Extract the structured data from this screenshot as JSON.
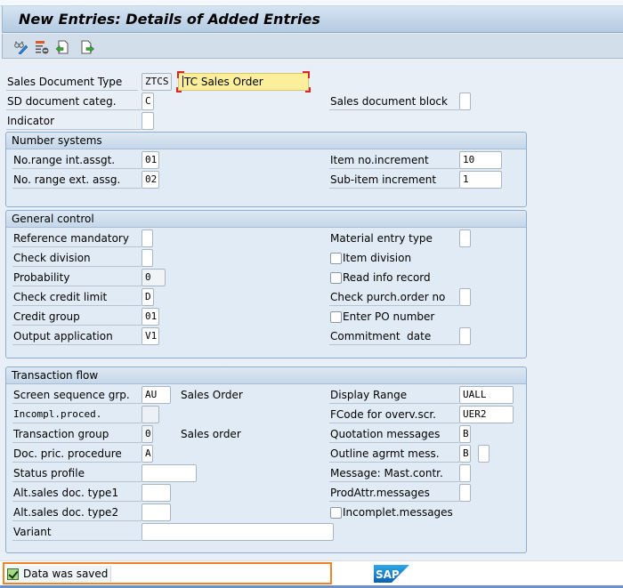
{
  "window": {
    "title": "New Entries: Details of Added Entries"
  },
  "toolbar": {
    "icons": [
      "display-change-icon",
      "delete-icon",
      "previous-entry-icon",
      "next-entry-icon"
    ]
  },
  "header": {
    "sales_document_type": {
      "label": "Sales Document Type",
      "value": "ZTCS",
      "description": "TC Sales Order"
    },
    "sd_document_categ": {
      "label": "SD document categ.",
      "value": "C"
    },
    "indicator": {
      "label": "Indicator",
      "value": ""
    },
    "sales_document_block": {
      "label": "Sales document block",
      "value": ""
    }
  },
  "number_systems": {
    "title": "Number systems",
    "no_range_int": {
      "label": "No.range int.assgt.",
      "value": "01"
    },
    "no_range_ext": {
      "label": "No. range ext. assg.",
      "value": "02"
    },
    "item_no_increment": {
      "label": "Item no.increment",
      "value": "10"
    },
    "sub_item_increment": {
      "label": "Sub-item increment",
      "value": "1"
    }
  },
  "general_control": {
    "title": "General control",
    "reference_mandatory": {
      "label": "Reference mandatory",
      "value": ""
    },
    "check_division": {
      "label": "Check division",
      "value": ""
    },
    "probability": {
      "label": "Probability",
      "value": "0"
    },
    "check_credit_limit": {
      "label": "Check credit limit",
      "value": "D"
    },
    "credit_group": {
      "label": "Credit group",
      "value": "01"
    },
    "output_application": {
      "label": "Output application",
      "value": "V1"
    },
    "material_entry_type": {
      "label": "Material entry type",
      "value": ""
    },
    "item_division": {
      "label": "Item division",
      "checked": false
    },
    "read_info_record": {
      "label": "Read info record",
      "checked": false
    },
    "check_purch_order_no": {
      "label": "Check purch.order no",
      "value": ""
    },
    "enter_po_number": {
      "label": "Enter PO number",
      "checked": false
    },
    "commitment_date": {
      "label": "Commitment  date",
      "value": ""
    }
  },
  "transaction_flow": {
    "title": "Transaction flow",
    "screen_sequence_grp": {
      "label": "Screen sequence grp.",
      "value": "AU",
      "description": "Sales Order"
    },
    "incompl_proced": {
      "label": "Incompl.proced.",
      "value": ""
    },
    "transaction_group": {
      "label": "Transaction group",
      "value": "0",
      "description": "Sales order"
    },
    "doc_pric_procedure": {
      "label": "Doc. pric. procedure",
      "value": "A"
    },
    "status_profile": {
      "label": "Status profile",
      "value": ""
    },
    "alt_sales_doc_type1": {
      "label": "Alt.sales doc. type1",
      "value": ""
    },
    "alt_sales_doc_type2": {
      "label": "Alt.sales doc. type2",
      "value": ""
    },
    "variant": {
      "label": "Variant",
      "value": ""
    },
    "display_range": {
      "label": "Display Range",
      "value": "UALL"
    },
    "fcode_overv_scr": {
      "label": "FCode for overv.scr.",
      "value": "UER2"
    },
    "quotation_messages": {
      "label": "Quotation messages",
      "value": "B"
    },
    "outline_agrmt_mess": {
      "label": "Outline agrmt mess.",
      "value": "B",
      "value2": ""
    },
    "message_mast_contr": {
      "label": "Message: Mast.contr.",
      "value": ""
    },
    "prodattr_messages": {
      "label": "ProdAttr.messages",
      "value": ""
    },
    "incomplet_messages": {
      "label": "Incomplet.messages",
      "checked": false
    }
  },
  "status": {
    "message": "Data was saved",
    "type": "success",
    "logo": "SAP"
  }
}
